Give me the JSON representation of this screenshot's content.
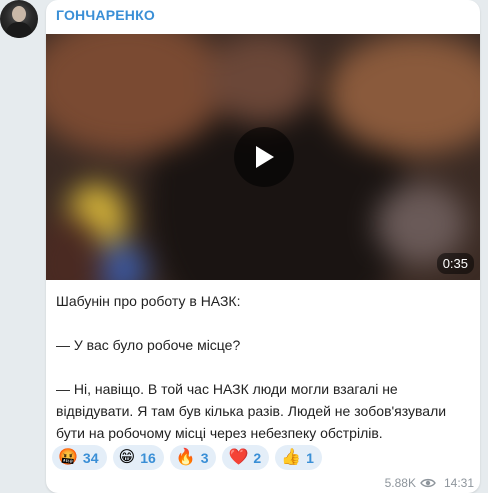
{
  "channel": {
    "name": "ГОНЧАРЕНКО"
  },
  "post": {
    "video": {
      "duration": "0:35"
    },
    "paragraphs": [
      "Шабунін про роботу в НАЗК:",
      "— У вас було робоче місце?",
      "— Ні, навіщо. В той час НАЗК люди могли взагалі не відвідувати. Я там був кілька разів. Людей не зобов'язували бути на робочому місці через небезпеку обстрілів."
    ],
    "reactions": [
      {
        "emoji": "🤬",
        "count": "34"
      },
      {
        "emoji": "😁",
        "count": "16"
      },
      {
        "emoji": "🔥",
        "count": "3"
      },
      {
        "emoji": "❤️",
        "count": "2"
      },
      {
        "emoji": "👍",
        "count": "1"
      }
    ],
    "views": "5.88K",
    "time": "14:31"
  },
  "colors": {
    "accent": "#3a8fd6",
    "background": "#e6ebee"
  },
  "icons": {
    "play": "play-icon",
    "views": "eye-icon"
  }
}
